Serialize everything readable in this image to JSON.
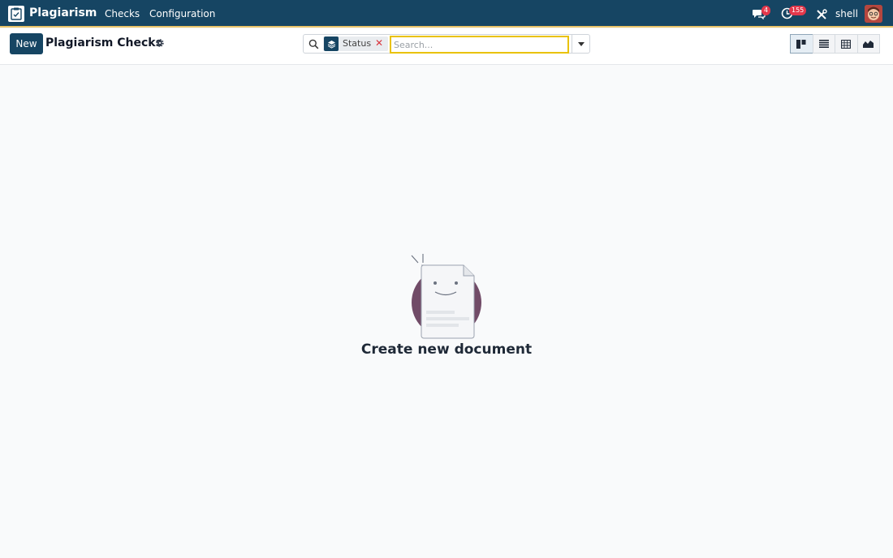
{
  "navbar": {
    "app_name": "Plagiarism",
    "menu": [
      {
        "label": "Checks"
      },
      {
        "label": "Configuration"
      }
    ],
    "messages_badge": "4",
    "activities_badge": "155",
    "user_name": "shell",
    "bg_color": "#164563"
  },
  "control": {
    "new_button": "New",
    "page_title": "Plagiarism Checks",
    "search": {
      "facet_label": "Status",
      "placeholder": "Search..."
    },
    "views": [
      "kanban-icon",
      "list-icon",
      "pivot-icon",
      "graph-icon"
    ]
  },
  "empty_state": {
    "title": "Create new document"
  }
}
